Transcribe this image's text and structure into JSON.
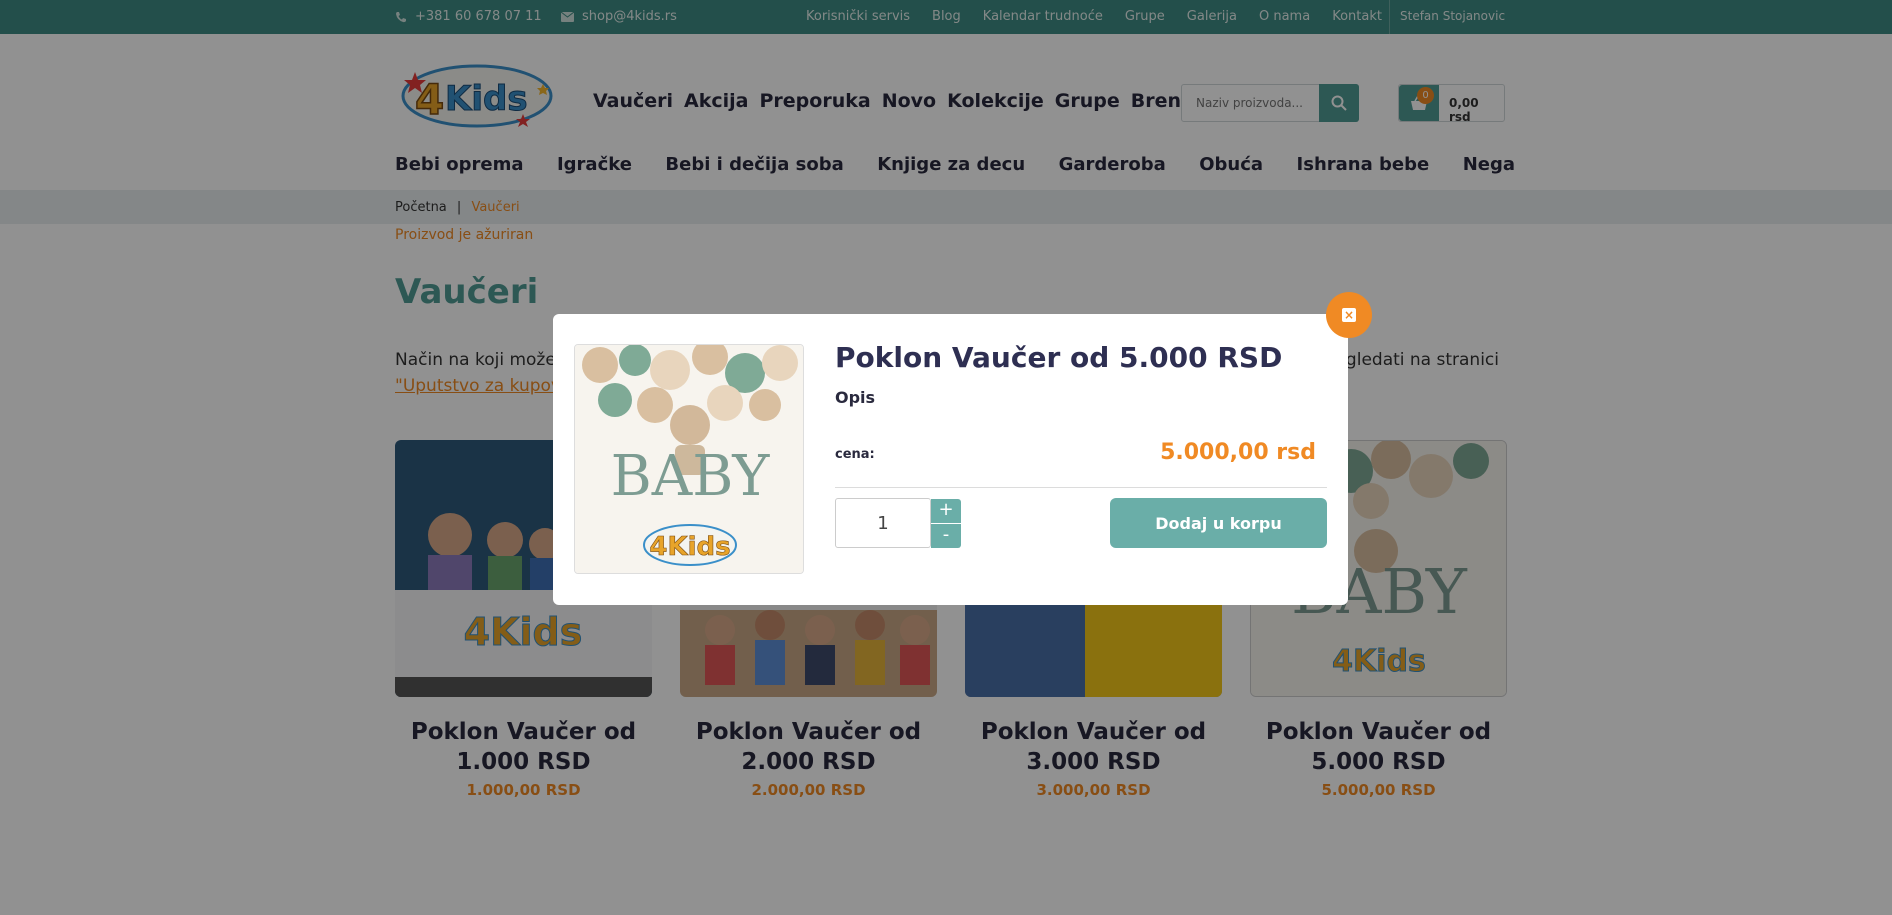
{
  "topbar": {
    "phone": "+381 60 678 07 11",
    "email": "shop@4kids.rs",
    "links": [
      "Korisnički servis",
      "Blog",
      "Kalendar trudnoće",
      "Grupe",
      "Galerija",
      "O nama",
      "Kontakt"
    ],
    "user": "Stefan Stojanovic"
  },
  "header": {
    "logo_text": "4Kids",
    "main_nav": [
      "Vaučeri",
      "Akcija",
      "Preporuka",
      "Novo",
      "Kolekcije",
      "Grupe",
      "Brendovi"
    ],
    "search_placeholder": "Naziv proizvoda...",
    "cart_count": "0",
    "cart_total": "0,00 rsd"
  },
  "category_nav": [
    "Bebi oprema",
    "Igračke",
    "Bebi i dečija soba",
    "Knjige za decu",
    "Garderoba",
    "Obuća",
    "Ishrana bebe",
    "Nega"
  ],
  "breadcrumb": {
    "home": "Početna",
    "separator": "|",
    "current": "Vaučeri"
  },
  "status_message": "Proizvod je ažuriran",
  "page": {
    "title": "Vaučeri",
    "intro_start": "Način na koji možete",
    "intro_end": "pogledati na stranici",
    "intro_link": "\"Uputstvo za kupovin"
  },
  "products": [
    {
      "name_line1": "Poklon Vaučer od",
      "name_line2": "1.000 RSD",
      "price": "1.000,00 RSD"
    },
    {
      "name_line1": "Poklon Vaučer od",
      "name_line2": "2.000 RSD",
      "price": "2.000,00 RSD"
    },
    {
      "name_line1": "Poklon Vaučer od",
      "name_line2": "3.000 RSD",
      "price": "3.000,00 RSD"
    },
    {
      "name_line1": "Poklon Vaučer od",
      "name_line2": "5.000 RSD",
      "price": "5.000,00 RSD"
    }
  ],
  "modal": {
    "title": "Poklon Vaučer od 5.000 RSD",
    "description_label": "Opis",
    "price_label": "cena:",
    "price": "5.000,00 rsd",
    "quantity": "1",
    "plus": "+",
    "minus": "-",
    "add_to_cart": "Dodaj u korpu",
    "image_text": "BABY",
    "image_logo": "4Kids"
  },
  "colors": {
    "primary": "#4f9b94",
    "accent": "#f08a24",
    "dark": "#2e2f52"
  }
}
